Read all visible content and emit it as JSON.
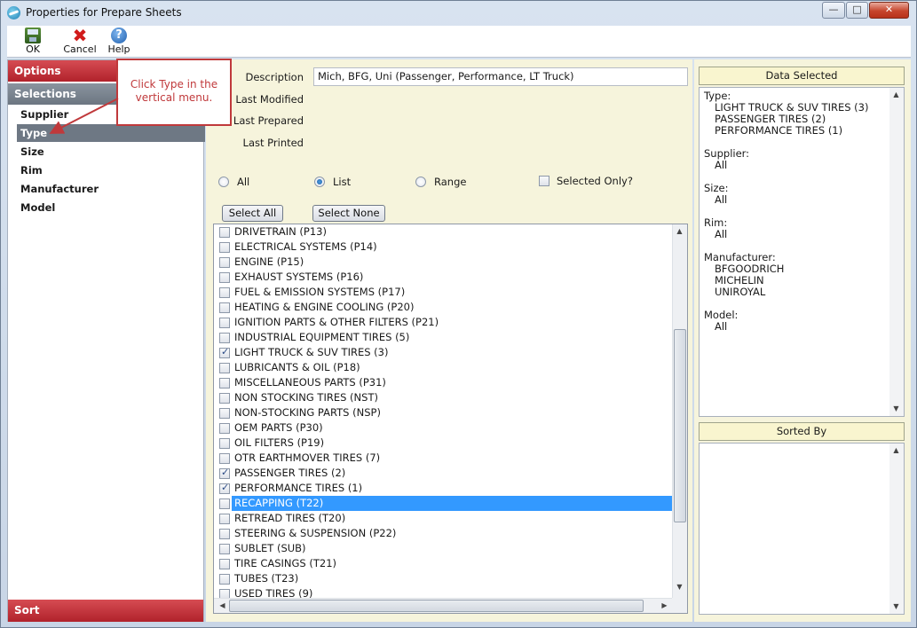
{
  "window": {
    "title": "Properties for Prepare Sheets",
    "controls": {
      "minimize": "—",
      "maximize": "□",
      "close": "✕"
    }
  },
  "toolbar": {
    "ok_label": "OK",
    "cancel_label": "Cancel",
    "help_label": "Help"
  },
  "leftnav": {
    "options_label": "Options",
    "selections_label": "Selections",
    "items": [
      "Supplier",
      "Type",
      "Size",
      "Rim",
      "Manufacturer",
      "Model"
    ],
    "active_item": "Type",
    "sort_label": "Sort"
  },
  "callout": {
    "text": "Click Type in the vertical menu."
  },
  "form": {
    "description_label": "Description",
    "description_value": "Mich, BFG, Uni (Passenger, Performance, LT Truck)",
    "last_modified_label": "Last Modified",
    "last_prepared_label": "Last Prepared",
    "last_printed_label": "Last Printed",
    "radio_all": "All",
    "radio_list": "List",
    "radio_range": "Range",
    "selected_radio": "List",
    "selected_only_label": "Selected Only?",
    "select_all_label": "Select All",
    "select_none_label": "Select None"
  },
  "type_list": {
    "rows": [
      {
        "label": "DRIVETRAIN (P13)",
        "checked": false
      },
      {
        "label": "ELECTRICAL SYSTEMS (P14)",
        "checked": false
      },
      {
        "label": "ENGINE (P15)",
        "checked": false
      },
      {
        "label": "EXHAUST SYSTEMS (P16)",
        "checked": false
      },
      {
        "label": "FUEL & EMISSION SYSTEMS (P17)",
        "checked": false
      },
      {
        "label": "HEATING & ENGINE COOLING (P20)",
        "checked": false
      },
      {
        "label": "IGNITION PARTS & OTHER FILTERS (P21)",
        "checked": false
      },
      {
        "label": "INDUSTRIAL EQUIPMENT TIRES (5)",
        "checked": false
      },
      {
        "label": "LIGHT TRUCK & SUV TIRES (3)",
        "checked": true
      },
      {
        "label": "LUBRICANTS & OIL (P18)",
        "checked": false
      },
      {
        "label": "MISCELLANEOUS PARTS (P31)",
        "checked": false
      },
      {
        "label": "NON STOCKING TIRES (NST)",
        "checked": false
      },
      {
        "label": "NON-STOCKING PARTS (NSP)",
        "checked": false
      },
      {
        "label": "OEM PARTS (P30)",
        "checked": false
      },
      {
        "label": "OIL FILTERS (P19)",
        "checked": false
      },
      {
        "label": "OTR EARTHMOVER TIRES (7)",
        "checked": false
      },
      {
        "label": "PASSENGER TIRES (2)",
        "checked": true
      },
      {
        "label": "PERFORMANCE TIRES (1)",
        "checked": true
      },
      {
        "label": "RECAPPING (T22)",
        "checked": false,
        "selected": true
      },
      {
        "label": "RETREAD TIRES (T20)",
        "checked": false
      },
      {
        "label": "STEERING & SUSPENSION (P22)",
        "checked": false
      },
      {
        "label": "SUBLET (SUB)",
        "checked": false
      },
      {
        "label": "TIRE CASINGS (T21)",
        "checked": false
      },
      {
        "label": "TUBES (T23)",
        "checked": false
      },
      {
        "label": "USED TIRES (9)",
        "checked": false
      }
    ]
  },
  "data_selected": {
    "header": "Data Selected",
    "groups": [
      {
        "title": "Type:",
        "values": [
          "LIGHT TRUCK & SUV TIRES (3)",
          "PASSENGER TIRES (2)",
          "PERFORMANCE TIRES (1)"
        ]
      },
      {
        "title": "Supplier:",
        "values": [
          "All"
        ]
      },
      {
        "title": "Size:",
        "values": [
          "All"
        ]
      },
      {
        "title": "Rim:",
        "values": [
          "All"
        ]
      },
      {
        "title": "Manufacturer:",
        "values": [
          "BFGOODRICH",
          "MICHELIN",
          "UNIROYAL"
        ]
      },
      {
        "title": "Model:",
        "values": [
          "All"
        ]
      }
    ]
  },
  "sorted_by": {
    "header": "Sorted By"
  },
  "colors": {
    "nav_red": "#c0313a",
    "nav_gray": "#7a848f",
    "panel_bg": "#f6f4dc",
    "highlight": "#3399ff",
    "callout": "#c0393b"
  }
}
